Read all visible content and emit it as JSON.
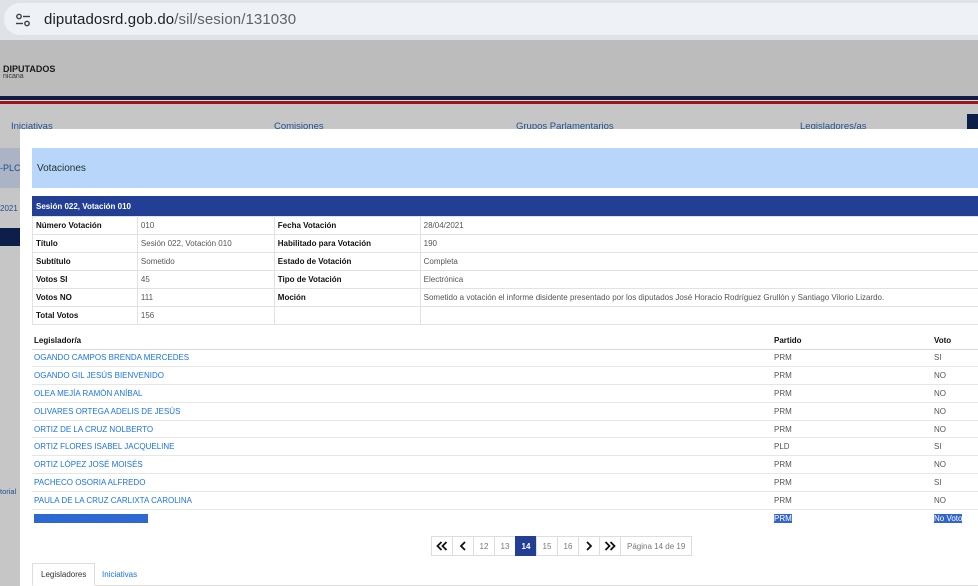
{
  "browser": {
    "url_host": "diputadosrd.gob.do",
    "url_path": "/sil/sesion/131030"
  },
  "background": {
    "logo_title": "DIPUTADOS",
    "logo_sub": "nicana",
    "nav": [
      "Iniciativas",
      "Comisiones",
      "Grupos Parlamentarios",
      "Legisladores/as"
    ],
    "side_label": "-PLC",
    "side_year": "2021 -",
    "side_hist": "torial"
  },
  "modal": {
    "title": "Votaciones",
    "section_title": "Sesión 022, Votación 010",
    "info_rows": [
      {
        "l1": "Número Votación",
        "v1": "010",
        "l2": "Fecha Votación",
        "v2": "28/04/2021"
      },
      {
        "l1": "Título",
        "v1": "Sesión 022, Votación 010",
        "l2": "Habilitado para Votación",
        "v2": "190"
      },
      {
        "l1": "Subtítulo",
        "v1": "Sometido",
        "l2": "Estado de Votación",
        "v2": "Completa"
      },
      {
        "l1": "Votos SI",
        "v1": "45",
        "l2": "Tipo de Votación",
        "v2": "Electrónica"
      },
      {
        "l1": "Votos NO",
        "v1": "111",
        "l2": "Moción",
        "v2": "Sometido a votación el informe disidente presentado por los diputados José Horacio Rodríguez Grullón y Santiago Vilorio Lizardo."
      },
      {
        "l1": "Total Votos",
        "v1": "156",
        "l2": "",
        "v2": ""
      }
    ],
    "votes_headers": {
      "name": "Legislador/a",
      "party": "Partido",
      "vote": "Voto"
    },
    "votes": [
      {
        "name": "OGANDO CAMPOS BRENDA MERCEDES",
        "party": "PRM",
        "vote": "SI"
      },
      {
        "name": "OGANDO GIL JESÚS BIENVENIDO",
        "party": "PRM",
        "vote": "NO"
      },
      {
        "name": "OLEA MEJÍA RAMÓN ANÍBAL",
        "party": "PRM",
        "vote": "NO"
      },
      {
        "name": "OLIVARES ORTEGA ADELIS DE JESÚS",
        "party": "PRM",
        "vote": "NO"
      },
      {
        "name": "ORTIZ DE LA CRUZ NOLBERTO",
        "party": "PRM",
        "vote": "NO"
      },
      {
        "name": "ORTIZ FLORES ISABEL JACQUELINE",
        "party": "PLD",
        "vote": "SI"
      },
      {
        "name": "ORTIZ LÓPEZ JOSÉ MOISÉS",
        "party": "PRM",
        "vote": "NO"
      },
      {
        "name": "PACHECO OSORIA ALFREDO",
        "party": "PRM",
        "vote": "SI"
      },
      {
        "name": "PAULA DE LA CRUZ CARLIXTA CAROLINA",
        "party": "PRM",
        "vote": "NO"
      },
      {
        "name": "PAULINO FRANCISCO JAVIER",
        "party": "PRM",
        "vote": "No Voto"
      }
    ],
    "pagination": {
      "first": "«",
      "prev": "‹",
      "pages": [
        "12",
        "13",
        "14",
        "15",
        "16"
      ],
      "current": "14",
      "next": "›",
      "last": "»",
      "info": "Página 14 de 19"
    },
    "tabs": [
      "Legisladores",
      "Iniciativas"
    ]
  },
  "colors": {
    "section_bar": "#233f95",
    "modal_header": "#b8d6f9",
    "link": "#1a73e8",
    "selection": "#3366cc"
  }
}
